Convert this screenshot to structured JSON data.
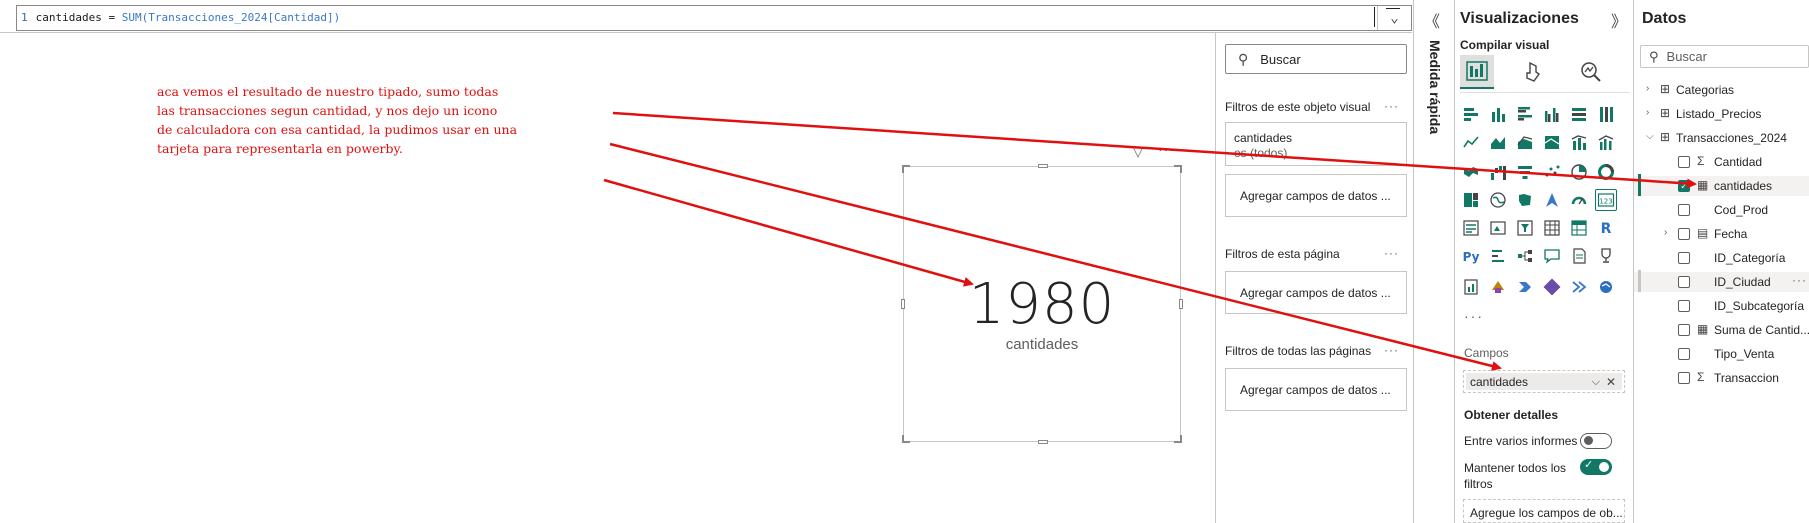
{
  "formula": {
    "line_number": "1",
    "measure_name": "cantidades",
    "operator": " = ",
    "function": "SUM",
    "argument": "(Transacciones_2024[Cantidad])"
  },
  "annotation": {
    "lines": [
      "aca vemos el resultado de nuestro tipado, sumo todas",
      "las transacciones segun cantidad, y nos dejo un icono",
      "de calculadora con esa cantidad, la pudimos usar en una",
      "tarjeta para representarla en powerby."
    ],
    "color": "#e01010"
  },
  "card": {
    "value": "1980",
    "label": "cantidades"
  },
  "filters": {
    "search_placeholder": "Buscar",
    "visual_title": "Filtros de este objeto visual",
    "visual_field_name": "cantidades",
    "visual_field_state": "es (todos)",
    "add_fields_label": "Agregar campos de datos ...",
    "page_title": "Filtros de esta página",
    "all_pages_title": "Filtros de todas las páginas",
    "more_glyph": "···"
  },
  "quick_measure": {
    "label": "Medida rápida",
    "collapse_glyph": "《"
  },
  "visualizations": {
    "title": "Visualizaciones",
    "expand_glyph": "》",
    "build_label": "Compilar visual",
    "more_glyph": "···",
    "fields_label": "Campos",
    "field_pill": "cantidades",
    "details_label": "Obtener detalles",
    "cross_report_label": "Entre varios informes",
    "keep_filters_label_1": "Mantener todos los",
    "keep_filters_label_2": "filtros",
    "drill_well_label": "Agregue los campos de ob...",
    "accent": "#117865"
  },
  "data_pane": {
    "title": "Datos",
    "search_placeholder": "Buscar",
    "items": [
      {
        "label": "Categorias",
        "kind": "table",
        "expanded": false
      },
      {
        "label": "Listado_Precios",
        "kind": "table",
        "expanded": false
      },
      {
        "label": "Transacciones_2024",
        "kind": "table",
        "expanded": true
      },
      {
        "label": "Cantidad",
        "kind": "sum",
        "checked": false
      },
      {
        "label": "cantidades",
        "kind": "measure",
        "checked": true
      },
      {
        "label": "Cod_Prod",
        "kind": "field",
        "checked": false
      },
      {
        "label": "Fecha",
        "kind": "date",
        "checked": false
      },
      {
        "label": "ID_Categoría",
        "kind": "field",
        "checked": false
      },
      {
        "label": "ID_Ciudad",
        "kind": "field",
        "checked": false
      },
      {
        "label": "ID_Subcategoría",
        "kind": "field",
        "checked": false
      },
      {
        "label": "Suma de Cantid...",
        "kind": "measure",
        "checked": false
      },
      {
        "label": "Tipo_Venta",
        "kind": "field",
        "checked": false
      },
      {
        "label": "Transaccion",
        "kind": "sum",
        "checked": false
      }
    ]
  }
}
